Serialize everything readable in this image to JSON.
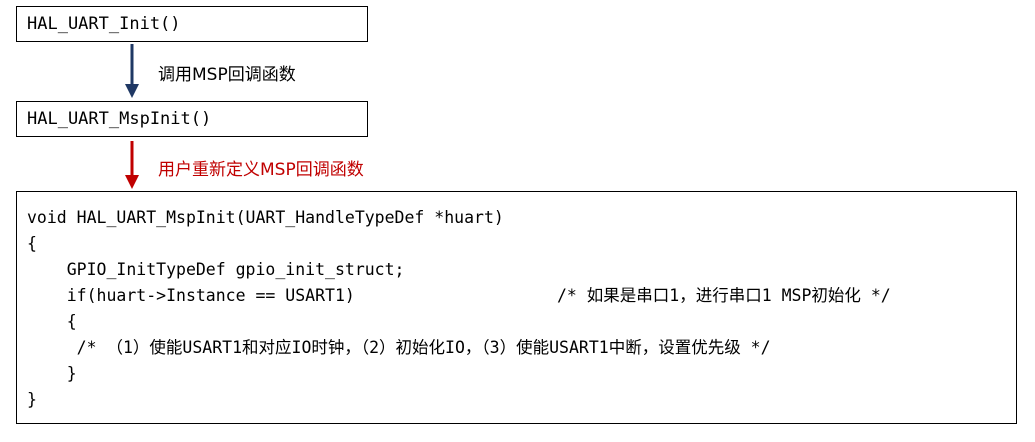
{
  "boxes": {
    "init": "HAL_UART_Init()",
    "msp_init": "HAL_UART_MspInit()"
  },
  "arrows": {
    "first_label": "调用MSP回调函数",
    "second_label": "用户重新定义MSP回调函数",
    "first_color": "#1f3864",
    "second_color": "#c00000"
  },
  "code": {
    "lines": [
      "void HAL_UART_MspInit(UART_HandleTypeDef *huart)",
      "{",
      "    GPIO_InitTypeDef gpio_init_struct;",
      "    if(huart->Instance == USART1)",
      "    {",
      "     /* （1）使能USART1和对应IO时钟，（2）初始化IO，（3）使能USART1中断，设置优先级 */",
      "    }",
      "}"
    ],
    "if_comment": "/* 如果是串口1，进行串口1 MSP初始化 */"
  }
}
